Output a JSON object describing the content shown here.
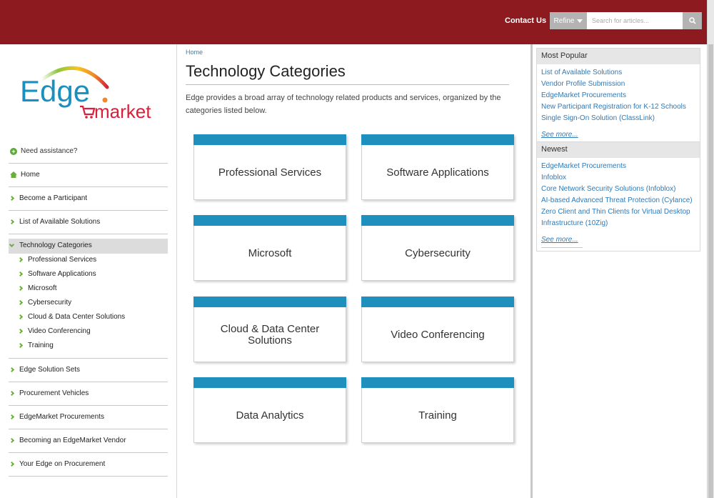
{
  "header": {
    "contact_label": "Contact Us",
    "refine_label": "Refine",
    "search_placeholder": "Search for articles..."
  },
  "logo": {
    "line1": "Edge",
    "line2": "market"
  },
  "sidebar": {
    "help_label": "Need assistance?",
    "items": [
      {
        "label": "Home"
      },
      {
        "label": "Become a Participant"
      },
      {
        "label": "List of Available Solutions"
      },
      {
        "label": "Technology Categories"
      },
      {
        "label": "Edge Solution Sets"
      },
      {
        "label": "Procurement Vehicles"
      },
      {
        "label": "EdgeMarket Procurements"
      },
      {
        "label": "Becoming an EdgeMarket Vendor"
      },
      {
        "label": "Your Edge on Procurement"
      }
    ],
    "sub_items": [
      {
        "label": "Professional Services"
      },
      {
        "label": "Software Applications"
      },
      {
        "label": "Microsoft"
      },
      {
        "label": "Cybersecurity"
      },
      {
        "label": "Cloud & Data Center Solutions"
      },
      {
        "label": "Video Conferencing"
      },
      {
        "label": "Training"
      }
    ]
  },
  "main": {
    "breadcrumb": "Home",
    "title": "Technology Categories",
    "intro": "Edge provides a broad array of technology related products and services, organized by the categories listed below.",
    "tiles": [
      {
        "label": "Professional Services"
      },
      {
        "label": "Software Applications"
      },
      {
        "label": "Microsoft"
      },
      {
        "label": "Cybersecurity"
      },
      {
        "label": "Cloud & Data Center Solutions"
      },
      {
        "label": "Video Conferencing"
      },
      {
        "label": "Data Analytics"
      },
      {
        "label": "Training"
      }
    ]
  },
  "right": {
    "popular": {
      "title": "Most Popular",
      "links": [
        {
          "label": "List of Available Solutions"
        },
        {
          "label": "Vendor Profile Submission"
        },
        {
          "label": "EdgeMarket Procurements"
        },
        {
          "label": "New Participant Registration for K-12 Schools"
        },
        {
          "label": "Single Sign-On Solution (ClassLink)"
        }
      ],
      "more": "See more..."
    },
    "newest": {
      "title": "Newest",
      "links": [
        {
          "label": "EdgeMarket Procurements"
        },
        {
          "label": "Infoblox"
        },
        {
          "label": "Core Network Security Solutions (Infoblox)"
        },
        {
          "label": "AI-based Advanced Threat Protection (Cylance)"
        },
        {
          "label": "Zero Client and Thin Clients for Virtual Desktop Infrastructure (10Zig)"
        }
      ],
      "more": "See more..."
    }
  },
  "colors": {
    "header_bg": "#8c1a1f",
    "tile_band": "#1f90bd",
    "link": "#2e7ab8",
    "chevron": "#6cae3c",
    "logo_blue": "#1a8fc0",
    "logo_red": "#d8203a"
  }
}
